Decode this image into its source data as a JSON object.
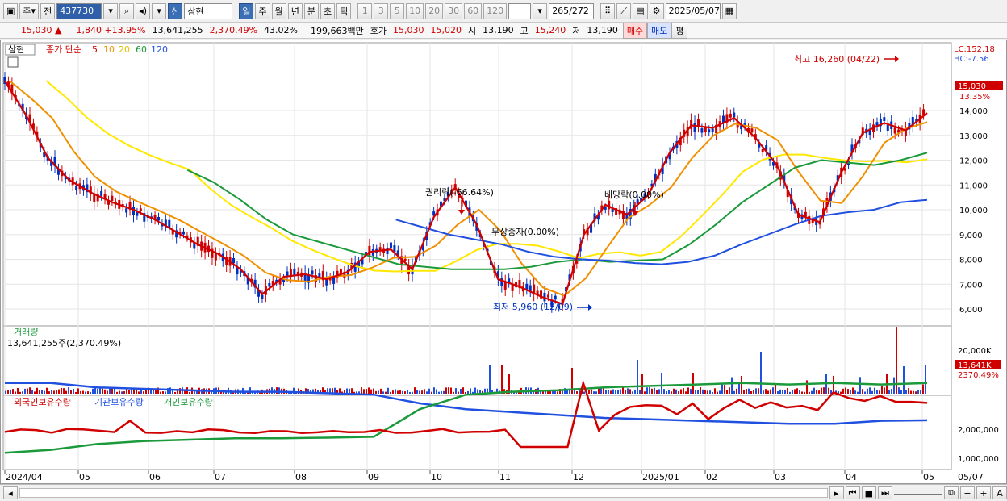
{
  "toolbar": {
    "period_type": "주",
    "prev_label": "전",
    "code": "437730",
    "name_badge": "신",
    "name": "삼현",
    "intervals": [
      "일",
      "주",
      "월",
      "년",
      "분",
      "초",
      "틱"
    ],
    "active_interval": "일",
    "minutes": [
      "1",
      "3",
      "5",
      "10",
      "20",
      "30",
      "60",
      "120"
    ],
    "count": "265",
    "count_total": "/272",
    "date": "2025/05/07"
  },
  "quote": {
    "price": "15,030 ▲",
    "change": "1,840 +13.95%",
    "volume": "13,641,255",
    "vol_ratio": "2,370.49%",
    "turnover": "43.02%",
    "amount": "199,663백만",
    "bid_label": "호가",
    "ask": "15,030",
    "bid": "15,020",
    "open_label": "시",
    "open": "13,190",
    "high_label": "고",
    "high": "15,240",
    "low_label": "저",
    "low": "13,190",
    "buy_label": "매수",
    "sell_label": "매도",
    "eval_label": "평"
  },
  "price_panel": {
    "name": "삼현",
    "ma_label": "종가 단순",
    "ma_periods": [
      "5",
      "10",
      "20",
      "60",
      "120"
    ],
    "ma_colors": [
      "#d00000",
      "#f09000",
      "#ffe800",
      "#1a9a3a",
      "#2050e0"
    ],
    "lc": "LC:152.18",
    "hc": "HC:-7.56",
    "cur_price": "15,030",
    "cur_pct": "13.35%",
    "y_ticks": [
      "14,000",
      "13,000",
      "12,000",
      "11,000",
      "10,000",
      "9,000",
      "8,000",
      "7,000",
      "6,000"
    ],
    "ann_high": "최고 16,260 (04/22)",
    "ann_low": "최저 5,960 (12/09)",
    "ann_rights": "권리락(-66.64%)",
    "ann_bonus": "무상증자(0.00%)",
    "ann_div": "배당락(0.00%)"
  },
  "volume_panel": {
    "title": "거래량",
    "value": "13,641,255주(2,370.49%)",
    "tick": "20,000K",
    "cur": "13,641K",
    "cur_pct": "2370.49%"
  },
  "holding_panel": {
    "legend": [
      "외국인보유수량",
      "기관보유수량",
      "개인보유수량"
    ],
    "legend_colors": [
      "#d00000",
      "#2050e0",
      "#1a9a3a"
    ],
    "ticks": [
      "2,000,000",
      "1,000,000"
    ]
  },
  "x_axis": [
    "2024/04",
    "05",
    "06",
    "07",
    "08",
    "09",
    "10",
    "11",
    "12",
    "2025/01",
    "02",
    "03",
    "04",
    "05"
  ],
  "x_right": "05/07",
  "chart_data": {
    "type": "line",
    "x_range": [
      "2024/04",
      "2025/05/07"
    ],
    "y_range": [
      5500,
      16500
    ],
    "series": [
      {
        "name": "5",
        "values": [
          15200,
          13800,
          12100,
          11200,
          10700,
          10300,
          10000,
          9600,
          9100,
          8600,
          8200,
          7600,
          6600,
          7300,
          7400,
          7200,
          7500,
          8300,
          8400,
          7600,
          9700,
          10900,
          9400,
          7200,
          6900,
          6500,
          6200,
          9000,
          10200,
          9800,
          10600,
          12300,
          13400,
          13300,
          13700,
          12900,
          11800,
          9800,
          9500,
          11500,
          13100,
          13500,
          13200,
          13900
        ]
      },
      {
        "name": "60",
        "values": [
          11600,
          11100,
          10400,
          9600,
          9000,
          8700,
          8400,
          8100,
          7800,
          7700,
          7600,
          7600,
          7600,
          7700,
          7900,
          8000,
          7900,
          7950,
          8000,
          8600,
          9400,
          10300,
          11000,
          11700,
          12000,
          11900,
          11800,
          12000,
          12300
        ]
      },
      {
        "name": "120",
        "values": [
          9600,
          9300,
          9000,
          8800,
          8600,
          8300,
          8100,
          8000,
          7950,
          7850,
          7800,
          7900,
          8150,
          8600,
          9000,
          9400,
          9750,
          9900,
          10000,
          10300,
          10400
        ]
      }
    ],
    "annotations": [
      "최고 16,260 (04/22)",
      "최저 5,960 (12/09)",
      "권리락(-66.64%)",
      "무상증자(0.00%)",
      "배당락(0.00%)"
    ]
  }
}
